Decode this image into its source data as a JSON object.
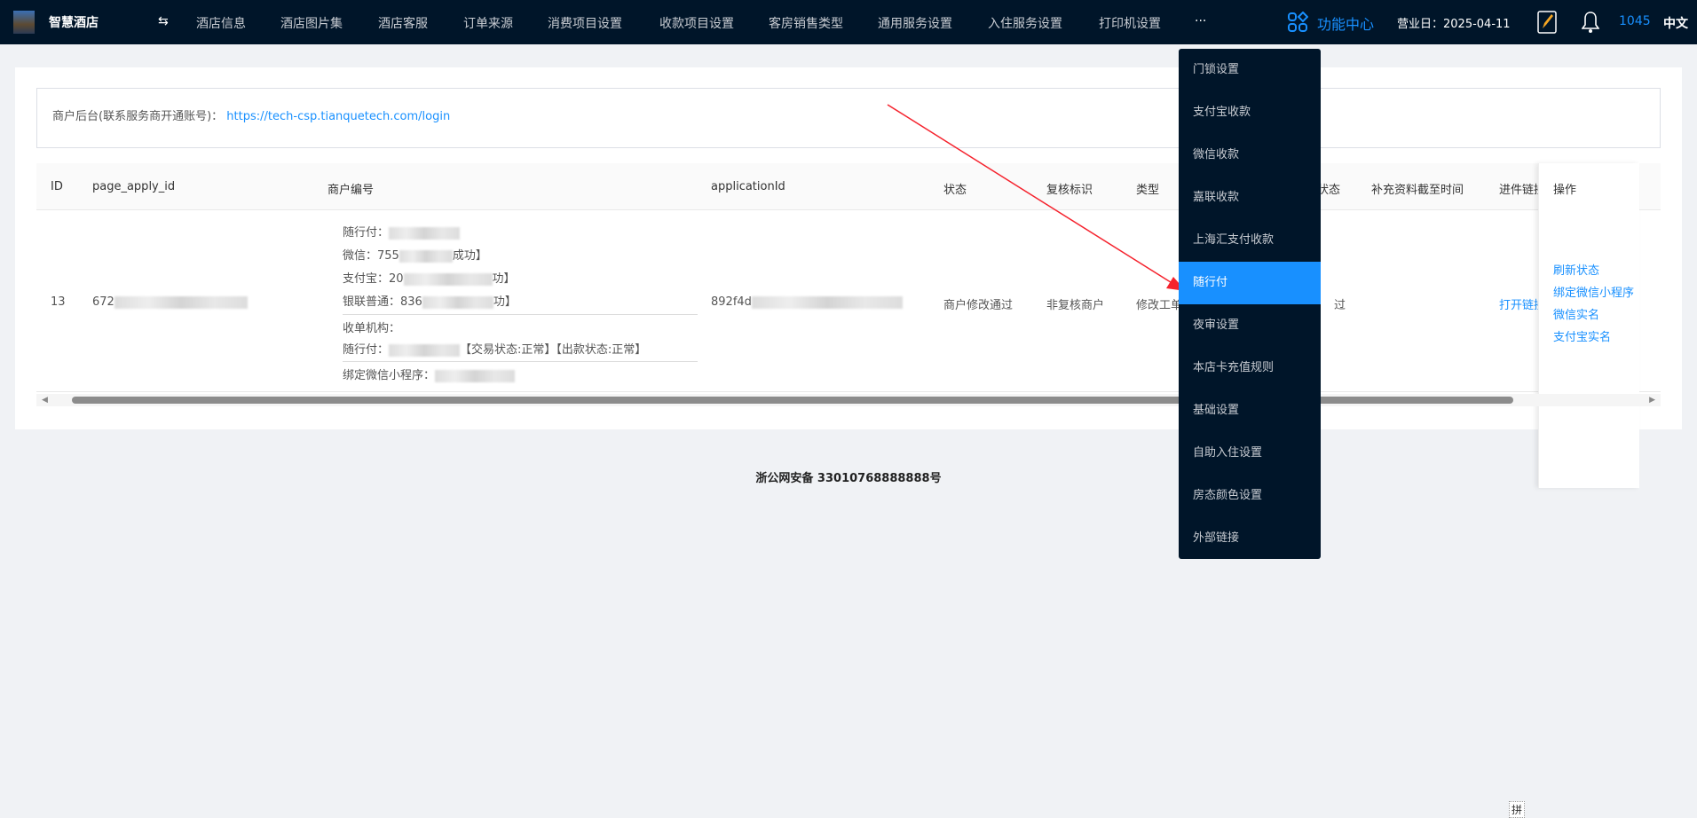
{
  "nav": {
    "brand": "智慧酒店",
    "toggle": "⇆",
    "items": [
      "酒店信息",
      "酒店图片集",
      "酒店客服",
      "订单来源",
      "消费项目设置",
      "收款项目设置",
      "客房销售类型",
      "通用服务设置",
      "入住服务设置",
      "打印机设置",
      "···"
    ],
    "function_center": "功能中心",
    "business_day": "营业日：2025-04-11",
    "count": "1045",
    "lang": "中文"
  },
  "info": {
    "label": "商户后台(联系服务商开通账号)：",
    "url": "https://tech-csp.tianquetech.com/login"
  },
  "table": {
    "headers": [
      "ID",
      "page_apply_id",
      "商户编号",
      "applicationId",
      "状态",
      "复核标识",
      "类型",
      "状态",
      "补充资料截至时间",
      "进件链接",
      "操作"
    ],
    "row": {
      "id": "13",
      "page_apply_id": "672",
      "merchant": {
        "l1": "随行付：",
        "l2a": "微信：755",
        "l2b": "成功】",
        "l3a": "支付宝：20",
        "l3b": "功】",
        "l4a": "银联普通：836",
        "l4b": "功】",
        "l5": "收单机构：",
        "l6a": "随行付：",
        "l6b": "【交易状态:正常】【出款状态:正常】",
        "l7": "绑定微信小程序："
      },
      "application_id": "892f4d",
      "status": "商户修改通过",
      "review": "非复核商户",
      "type": "修改工单",
      "status2": "过",
      "link": "打开链接",
      "actions": [
        "刷新状态",
        "绑定微信小程序",
        "微信实名",
        "支付宝实名"
      ]
    }
  },
  "footer": "浙公网安备 33010768888888号",
  "menu": {
    "items": [
      "门锁设置",
      "支付宝收款",
      "微信收款",
      "嘉联收款",
      "上海汇支付收款",
      "随行付",
      "夜审设置",
      "本店卡充值规则",
      "基础设置",
      "自助入住设置",
      "房态颜色设置",
      "外部链接"
    ],
    "active": "随行付"
  },
  "ime": "拼"
}
